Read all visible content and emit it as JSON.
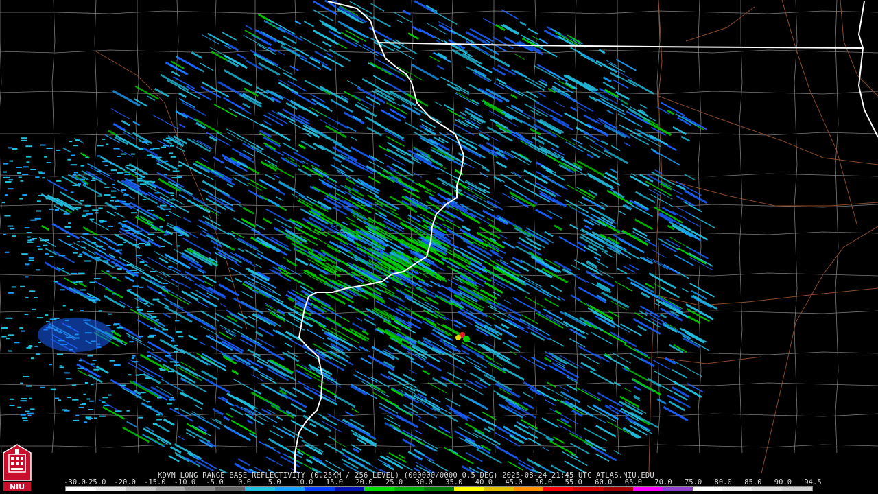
{
  "product": {
    "text": "KDVN LONG RANGE BASE REFLECTIVITY (0.25KM / 256 LEVEL) (000000/0000 0.5 DEG) 2025-08-24 21:45 UTC  ATLAS.NIU.EDU"
  },
  "scale": {
    "labels": [
      "-30.0",
      "-25.0",
      "-20.0",
      "-15.0",
      "-10.0",
      "-5.0",
      "0.0",
      "5.0",
      "10.0",
      "15.0",
      "20.0",
      "25.0",
      "30.0",
      "35.0",
      "40.0",
      "45.0",
      "50.0",
      "55.0",
      "60.0",
      "65.0",
      "70.0",
      "75.0",
      "80.0",
      "85.0",
      "90.0",
      "94.5"
    ],
    "colors": [
      "#ffffff",
      "#e8e8e8",
      "#c8c8c8",
      "#a8a8a8",
      "#888888",
      "#666666",
      "#22c0e0",
      "#1aa0ff",
      "#0040ff",
      "#0010b0",
      "#00e000",
      "#00b000",
      "#008000",
      "#ffff00",
      "#e0c000",
      "#ff9000",
      "#ff0000",
      "#d00000",
      "#a00000",
      "#ff00ff",
      "#9040d0",
      "#ffffff",
      "#f0f0f0",
      "#e0e0e0",
      "#d0d0d0"
    ]
  },
  "logo": {
    "label": "NIU"
  },
  "colors": {
    "state_border": "#ffffff",
    "county_border": "#808080",
    "road": "#8b4a2a",
    "echo_light": "#22c0e0",
    "echo_mid": "#1a60ff",
    "echo_green": "#00d000",
    "echo_yellow": "#e0e000",
    "echo_red": "#e02020"
  }
}
